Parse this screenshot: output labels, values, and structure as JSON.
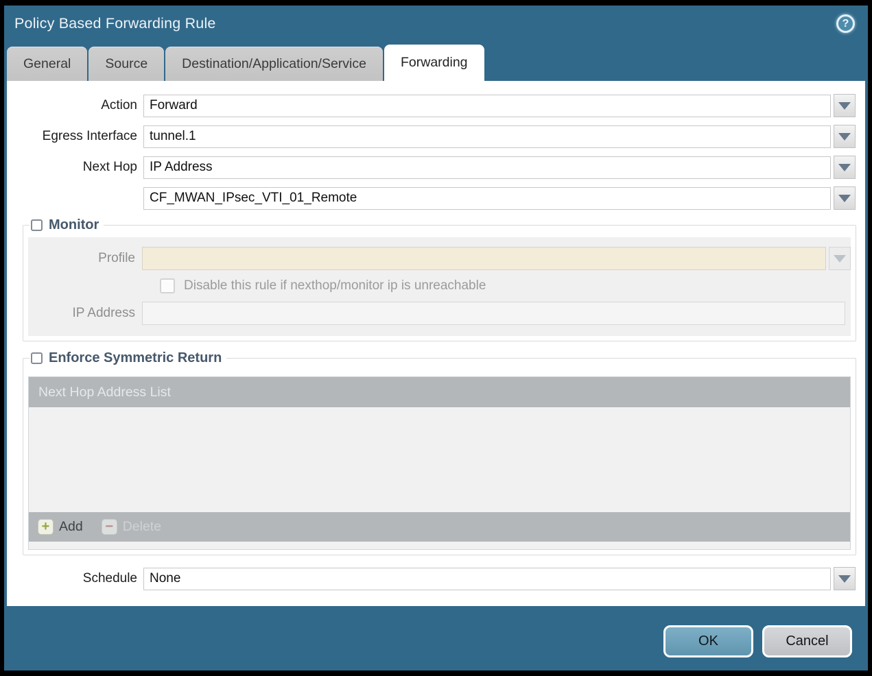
{
  "window": {
    "title": "Policy Based Forwarding Rule"
  },
  "icons": {
    "help": "question-mark-circle",
    "dropdown": "down-triangle",
    "add": "+",
    "delete": "−"
  },
  "tabs": {
    "items": [
      {
        "label": "General",
        "active": false
      },
      {
        "label": "Source",
        "active": false
      },
      {
        "label": "Destination/Application/Service",
        "active": false
      },
      {
        "label": "Forwarding",
        "active": true
      }
    ]
  },
  "form": {
    "action": {
      "label": "Action",
      "value": "Forward"
    },
    "egress_interface": {
      "label": "Egress Interface",
      "value": "tunnel.1"
    },
    "next_hop": {
      "label": "Next Hop",
      "value": "IP Address"
    },
    "next_hop_address": {
      "value": "CF_MWAN_IPsec_VTI_01_Remote"
    },
    "schedule": {
      "label": "Schedule",
      "value": "None"
    }
  },
  "monitor": {
    "legend": "Monitor",
    "checked": false,
    "profile": {
      "label": "Profile",
      "value": ""
    },
    "disable_rule": {
      "label": "Disable this rule if nexthop/monitor ip is unreachable",
      "checked": false
    },
    "ip_address": {
      "label": "IP Address",
      "value": ""
    }
  },
  "enforce_symmetric_return": {
    "legend": "Enforce Symmetric Return",
    "checked": false,
    "table": {
      "header": "Next Hop Address List",
      "rows": []
    },
    "toolbar": {
      "add_label": "Add",
      "delete_label": "Delete",
      "delete_enabled": false
    }
  },
  "buttons": {
    "ok": "OK",
    "cancel": "Cancel"
  },
  "colors": {
    "titlebar": "#31698a",
    "tab_inactive": "#c7c7c8",
    "tab_active": "#ffffff",
    "disabled_field_cream": "#f2ecd9",
    "panel_gray": "#f0f0f1",
    "table_bar_gray": "#b3b7ba",
    "ok_button": "#6fa3bb",
    "cancel_button": "#c9cacd",
    "legend_text": "#46586b"
  }
}
